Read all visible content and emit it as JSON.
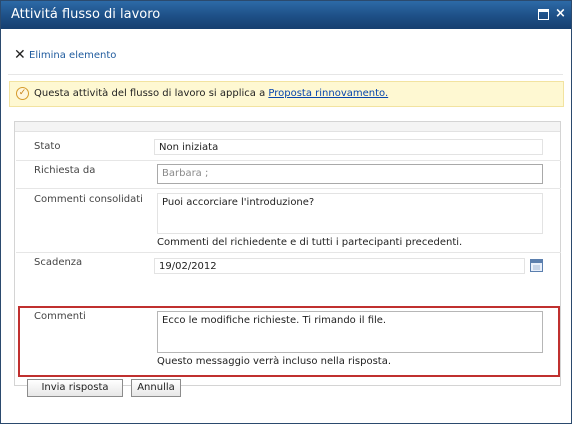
{
  "window": {
    "title": "Attivitá flusso di lavoro"
  },
  "toolbar": {
    "delete_label": "Elimina elemento"
  },
  "notice": {
    "text": "Questa attività del flusso di lavoro si applica a ",
    "link": "Proposta rinnovamento."
  },
  "form": {
    "status": {
      "label": "Stato",
      "value": "Non iniziata"
    },
    "requested_by": {
      "label": "Richiesta da",
      "value": "Barbara ;"
    },
    "consolidated_comments": {
      "label": "Commenti consolidati",
      "value": "Puoi accorciare l'introduzione?",
      "hint": "Commenti del richiedente e di tutti i partecipanti precedenti."
    },
    "due_date": {
      "label": "Scadenza",
      "value": "19/02/2012"
    },
    "comments": {
      "label": "Commenti",
      "value": "Ecco le modifiche richieste. Ti rimando il file.",
      "hint": "Questo messaggio verrà incluso nella risposta."
    }
  },
  "buttons": {
    "send": "Invia risposta",
    "cancel": "Annulla"
  },
  "colors": {
    "title_bar": "#1d4f86",
    "highlight": "#c0302f",
    "notice_bg": "#fef8d2"
  },
  "icons": [
    "maximize-icon",
    "close-icon",
    "delete-x-icon",
    "task-check-icon",
    "calendar-icon"
  ]
}
